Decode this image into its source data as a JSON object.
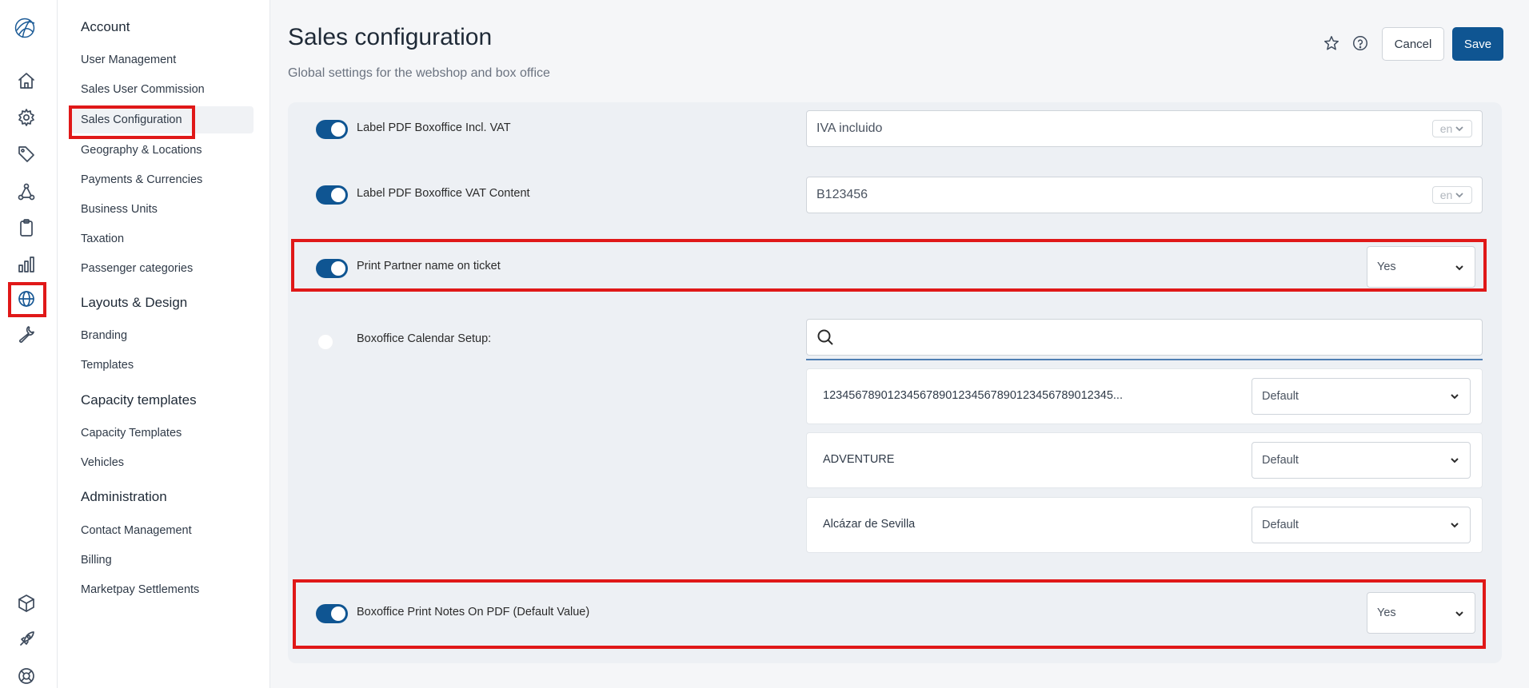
{
  "rail": {
    "icons": [
      "logo-icon",
      "home-icon",
      "gear-icon",
      "tag-icon",
      "network-icon",
      "clipboard-icon",
      "bar-chart-icon",
      "globe-icon",
      "wrench-icon",
      "cube-icon",
      "rocket-icon",
      "lifebuoy-icon"
    ],
    "active": "globe-icon"
  },
  "menu": {
    "groups": {
      "account": "Account",
      "layouts": "Layouts & Design",
      "capacity": "Capacity templates",
      "administration": "Administration"
    },
    "items": {
      "user_management": "User Management",
      "sales_user_commission": "Sales User Commission",
      "sales_configuration": "Sales Configuration",
      "geography": "Geography & Locations",
      "payments": "Payments & Currencies",
      "business_units": "Business Units",
      "taxation": "Taxation",
      "passenger_categories": "Passenger categories",
      "branding": "Branding",
      "templates": "Templates",
      "capacity_templates": "Capacity Templates",
      "vehicles": "Vehicles",
      "contact_management": "Contact Management",
      "billing": "Billing",
      "marketpay": "Marketpay Settlements"
    },
    "selected": "Sales Configuration"
  },
  "header": {
    "title": "Sales configuration",
    "subtitle": "Global settings for the webshop and box office",
    "cancel_label": "Cancel",
    "save_label": "Save"
  },
  "settings": {
    "vat_incl": {
      "label": "Label PDF Boxoffice Incl. VAT",
      "value": "IVA incluido",
      "lang": "en",
      "enabled": true
    },
    "vat_content": {
      "label": "Label PDF Boxoffice VAT Content",
      "value": "B123456",
      "lang": "en",
      "enabled": true
    },
    "print_partner": {
      "label": "Print Partner name on ticket",
      "value": "Yes",
      "enabled": true
    },
    "calendar": {
      "label": "Boxoffice Calendar Setup:",
      "enabled": false,
      "search_placeholder": "",
      "rows": [
        {
          "name": "123456789012345678901234567890123456789012345...",
          "value": "Default"
        },
        {
          "name": "ADVENTURE",
          "value": "Default"
        },
        {
          "name": "Alcázar de Sevilla",
          "value": "Default"
        }
      ]
    },
    "print_notes": {
      "label": "Boxoffice Print Notes On PDF (Default Value)",
      "value": "Yes",
      "enabled": true
    }
  },
  "colors": {
    "accent": "#0f5592",
    "highlight": "#e01818"
  }
}
